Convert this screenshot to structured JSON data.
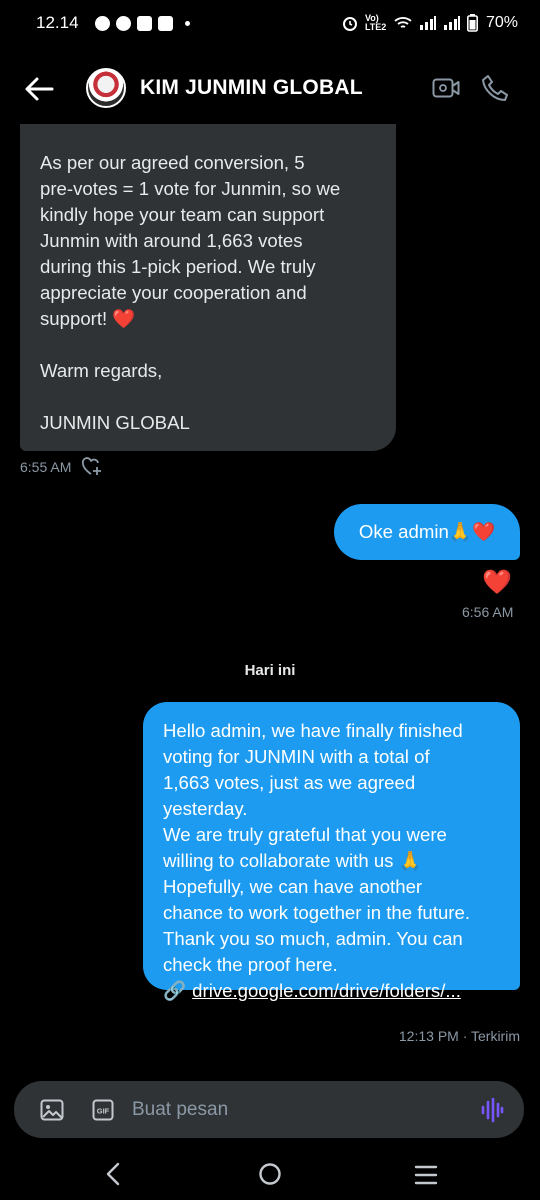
{
  "status_bar": {
    "time": "12.14",
    "network_label": "Vo) LTE2",
    "battery": "70%"
  },
  "header": {
    "title": "KIM JUNMIN GLOBAL"
  },
  "messages": {
    "incoming": {
      "paragraph1": [
        "As per our agreed conversion, 5",
        "pre-votes = 1 vote for Junmin, so we",
        "kindly hope your team can support",
        "Junmin with around 1,663 votes",
        "during this 1-pick period. We truly",
        "appreciate your cooperation and",
        "support!"
      ],
      "heart_emoji": "❤️",
      "paragraph2": "Warm regards,",
      "paragraph3": "JUNMIN GLOBAL",
      "time": "6:55 AM"
    },
    "outgoing1": {
      "text": "Oke admin🙏❤️",
      "reaction": "❤️",
      "time": "6:56 AM"
    },
    "day_separator": "Hari ini",
    "outgoing2": {
      "lines": [
        "Hello admin, we have finally finished",
        "voting for JUNMIN with a total of",
        "1,663 votes, just as we agreed",
        "yesterday.",
        "We are truly grateful that you were",
        "willing to collaborate with us 🙏",
        "Hopefully, we can have another",
        "chance to work together in the future.",
        "Thank you so much, admin. You can",
        "check the proof here."
      ],
      "link_emoji": "🔗",
      "link": "drive.google.com/drive/folders/...",
      "status": "12:13 PM · Terkirim"
    }
  },
  "composer": {
    "placeholder": "Buat pesan",
    "gif_label": "GIF"
  },
  "colors": {
    "background": "#000000",
    "incoming_bubble": "#2f3336",
    "outgoing_bubble": "#1d9bf0",
    "meta_text": "#8b98a5",
    "voice_icon": "#7856ff"
  }
}
